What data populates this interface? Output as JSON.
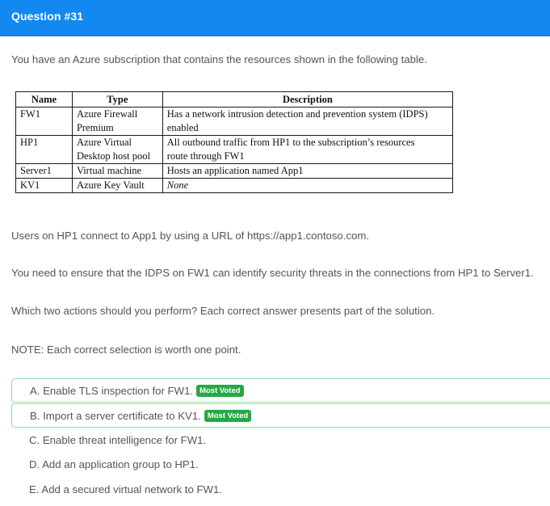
{
  "header": {
    "title": "Question #31"
  },
  "question": {
    "intro": "You have an Azure subscription that contains the resources shown in the following table.",
    "table": {
      "headers": [
        "Name",
        "Type",
        "Description"
      ],
      "rows": [
        {
          "name": "FW1",
          "type_lines": [
            "Azure Firewall",
            "Premium"
          ],
          "desc_lines": [
            "Has a network intrusion detection and prevention system (IDPS)",
            "enabled"
          ]
        },
        {
          "name": "HP1",
          "type_lines": [
            "Azure Virtual",
            "Desktop host pool"
          ],
          "desc_lines": [
            "All outbound traffic from HP1 to the subscription’s resources",
            "route through FW1"
          ]
        },
        {
          "name": "Server1",
          "type_lines": [
            "Virtual machine"
          ],
          "desc_lines": [
            "Hosts an application named App1"
          ]
        },
        {
          "name": "KV1",
          "type_lines": [
            "Azure Key Vault"
          ],
          "desc_lines": [
            "None"
          ]
        }
      ]
    },
    "users": "Users on HP1 connect to App1 by using a URL of https://app1.contoso.com.",
    "need": "You need to ensure that the IDPS on FW1 can identify security threats in the connections from HP1 to Server1.",
    "which": "Which two actions should you perform? Each correct answer presents part of the solution.",
    "note": "NOTE: Each correct selection is worth one point."
  },
  "answers": [
    {
      "text": "A. Enable TLS inspection for FW1.",
      "badge": "Most Voted"
    },
    {
      "text": "B. Import a server certificate to KV1.",
      "badge": "Most Voted"
    },
    {
      "text": "C. Enable threat intelligence for FW1."
    },
    {
      "text": "D. Add an application group to HP1."
    },
    {
      "text": "E. Add a secured virtual network to FW1."
    }
  ],
  "colors": {
    "header": "#1288f0",
    "badge": "#28a745",
    "voted_border": "#9bd99f"
  }
}
